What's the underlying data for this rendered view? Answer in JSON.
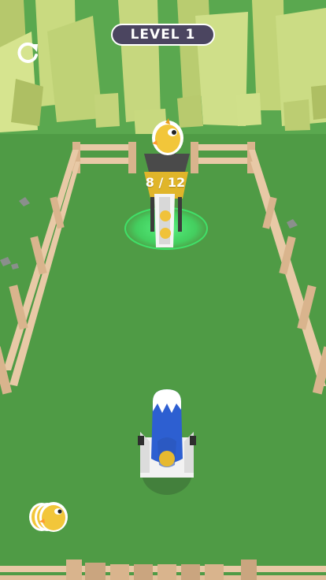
{
  "hud": {
    "level_label": "LEVEL 1",
    "restart_icon": "restart-icon"
  },
  "collector": {
    "counter_text": "8 / 12",
    "collected": 8,
    "capacity": 12,
    "chick_icon": "chick-icon"
  },
  "cannon": {
    "icon": "cannon-icon",
    "color": "#2d5fd1"
  },
  "reserve": {
    "icon": "chick-stack-icon",
    "count": 3
  },
  "colors": {
    "grass": "#4f9b45",
    "fence": "#e8c9a6",
    "trees": "#c8d97a",
    "hud_pill": "#4b4560",
    "machine": "#e0b52a",
    "glow": "#3df070"
  }
}
